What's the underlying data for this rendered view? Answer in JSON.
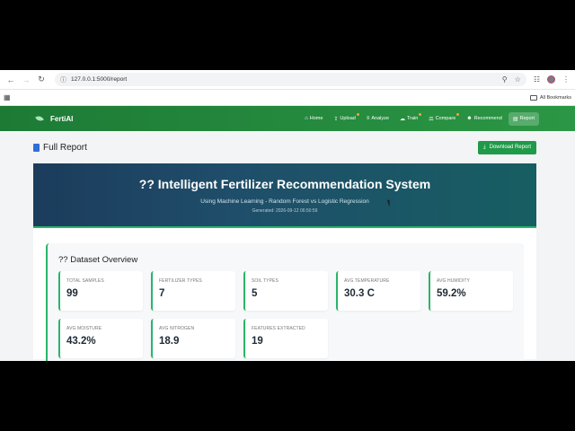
{
  "browser": {
    "url": "127.0.0.1:5000/report",
    "bookmarks_label": "All Bookmarks"
  },
  "nav": {
    "brand": "FertiAI",
    "items": [
      {
        "label": "Home",
        "icon": "home-icon",
        "dot": false,
        "active": false
      },
      {
        "label": "Upload",
        "icon": "upload-icon",
        "dot": true,
        "active": false
      },
      {
        "label": "Analyze",
        "icon": "chart-icon",
        "dot": false,
        "active": false
      },
      {
        "label": "Train",
        "icon": "brain-icon",
        "dot": true,
        "active": false
      },
      {
        "label": "Compare",
        "icon": "scale-icon",
        "dot": true,
        "active": false
      },
      {
        "label": "Recommend",
        "icon": "user-icon",
        "dot": false,
        "active": false
      },
      {
        "label": "Report",
        "icon": "file-icon",
        "dot": false,
        "active": true
      }
    ]
  },
  "page": {
    "title": "Full Report",
    "download_label": "Download Report"
  },
  "hero": {
    "title": "?? Intelligent Fertilizer Recommendation System",
    "subtitle": "Using Machine Learning - Random Forest vs Logistic Regression",
    "generated": "Generated: 2026-09-12 06:50:59"
  },
  "overview": {
    "title": "?? Dataset Overview",
    "cards": [
      {
        "label": "Total Samples",
        "value": "99"
      },
      {
        "label": "Fertilizer Types",
        "value": "7"
      },
      {
        "label": "Soil Types",
        "value": "5"
      },
      {
        "label": "Avg Temperature",
        "value": "30.3 C"
      },
      {
        "label": "Avg Humidity",
        "value": "59.2%"
      },
      {
        "label": "Avg Moisture",
        "value": "43.2%"
      },
      {
        "label": "Avg Nitrogen",
        "value": "18.9"
      },
      {
        "label": "Features Extracted",
        "value": "19"
      }
    ]
  },
  "colors": {
    "nav_green": "#1f8a3c",
    "accent_green": "#2bb46a",
    "hero_navy": "#1c3c5c",
    "dot_orange": "#f4a534"
  }
}
